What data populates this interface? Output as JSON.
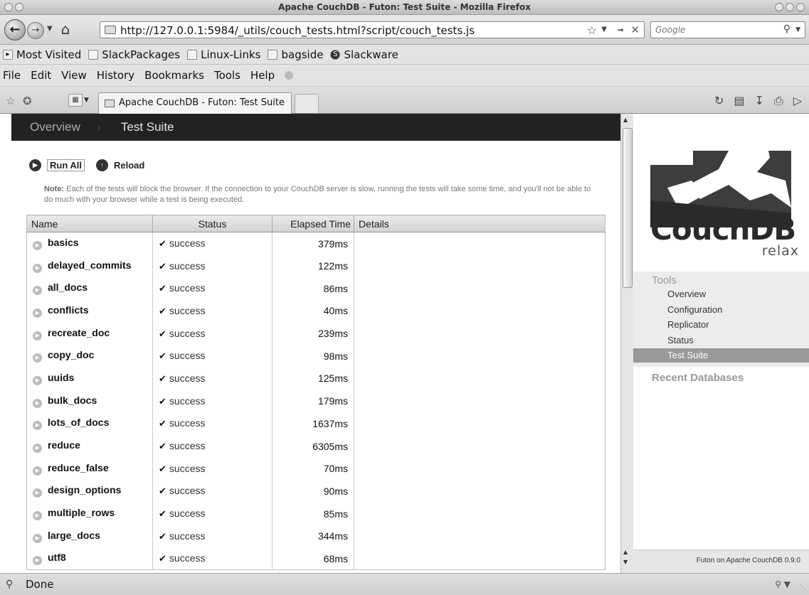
{
  "window": {
    "title": "Apache CouchDB - Futon: Test Suite - Mozilla Firefox"
  },
  "navbar": {
    "url": "http://127.0.0.1:5984/_utils/couch_tests.html?script/couch_tests.js",
    "search_placeholder": "Google"
  },
  "bookmarks": [
    {
      "label": "Most Visited"
    },
    {
      "label": "SlackPackages"
    },
    {
      "label": "Linux-Links"
    },
    {
      "label": "bagside"
    },
    {
      "label": "Slackware"
    }
  ],
  "menu": {
    "file": "File",
    "edit": "Edit",
    "view": "View",
    "history": "History",
    "bookmarks": "Bookmarks",
    "tools": "Tools",
    "help": "Help"
  },
  "tab": {
    "label": "Apache CouchDB - Futon: Test Suite"
  },
  "breadcrumb": {
    "overview": "Overview",
    "separator": "›",
    "current": "Test Suite"
  },
  "toolbar": {
    "run_all": "Run All",
    "reload": "Reload"
  },
  "note": {
    "label": "Note:",
    "text": "Each of the tests will block the browser. If the connection to your CouchDB server is slow, running the tests will take some time, and you'll not be able to do much with your browser while a test is being executed."
  },
  "table": {
    "headers": {
      "name": "Name",
      "status": "Status",
      "elapsed": "Elapsed Time",
      "details": "Details"
    },
    "rows": [
      {
        "name": "basics",
        "status": "success",
        "time": "379ms"
      },
      {
        "name": "delayed_commits",
        "status": "success",
        "time": "122ms"
      },
      {
        "name": "all_docs",
        "status": "success",
        "time": "86ms"
      },
      {
        "name": "conflicts",
        "status": "success",
        "time": "40ms"
      },
      {
        "name": "recreate_doc",
        "status": "success",
        "time": "239ms"
      },
      {
        "name": "copy_doc",
        "status": "success",
        "time": "98ms"
      },
      {
        "name": "uuids",
        "status": "success",
        "time": "125ms"
      },
      {
        "name": "bulk_docs",
        "status": "success",
        "time": "179ms"
      },
      {
        "name": "lots_of_docs",
        "status": "success",
        "time": "1637ms"
      },
      {
        "name": "reduce",
        "status": "success",
        "time": "6305ms"
      },
      {
        "name": "reduce_false",
        "status": "success",
        "time": "70ms"
      },
      {
        "name": "design_options",
        "status": "success",
        "time": "90ms"
      },
      {
        "name": "multiple_rows",
        "status": "success",
        "time": "85ms"
      },
      {
        "name": "large_docs",
        "status": "success",
        "time": "344ms"
      },
      {
        "name": "utf8",
        "status": "success",
        "time": "68ms"
      }
    ]
  },
  "sidebar": {
    "logo_word": "CouchDB",
    "logo_tagline": "relax",
    "tools_header": "Tools",
    "items": [
      {
        "label": "Overview"
      },
      {
        "label": "Configuration"
      },
      {
        "label": "Replicator"
      },
      {
        "label": "Status"
      },
      {
        "label": "Test Suite"
      }
    ],
    "recent_header": "Recent Databases",
    "footer": "Futon on Apache CouchDB 0.9.0"
  },
  "statusbar": {
    "text": "Done"
  }
}
